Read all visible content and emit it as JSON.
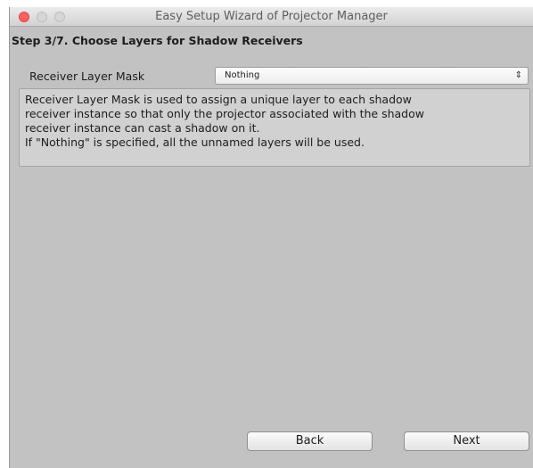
{
  "window": {
    "title": "Easy Setup Wizard of Projector Manager"
  },
  "step": {
    "title": "Step 3/7. Choose Layers for Shadow Receivers"
  },
  "receiver_layer_mask": {
    "label": "Receiver Layer Mask",
    "value": "Nothing"
  },
  "help": {
    "lines": [
      "Receiver Layer Mask is used to assign a unique layer to each shadow",
      "receiver instance so that only the projector associated with the shadow",
      "receiver instance can cast a shadow on it.",
      "If \"Nothing\" is specified, all the unnamed layers will be used."
    ]
  },
  "buttons": {
    "back": "Back",
    "next": "Next"
  },
  "colors": {
    "close": "#fc605b",
    "window_bg": "#c2c2c2"
  }
}
